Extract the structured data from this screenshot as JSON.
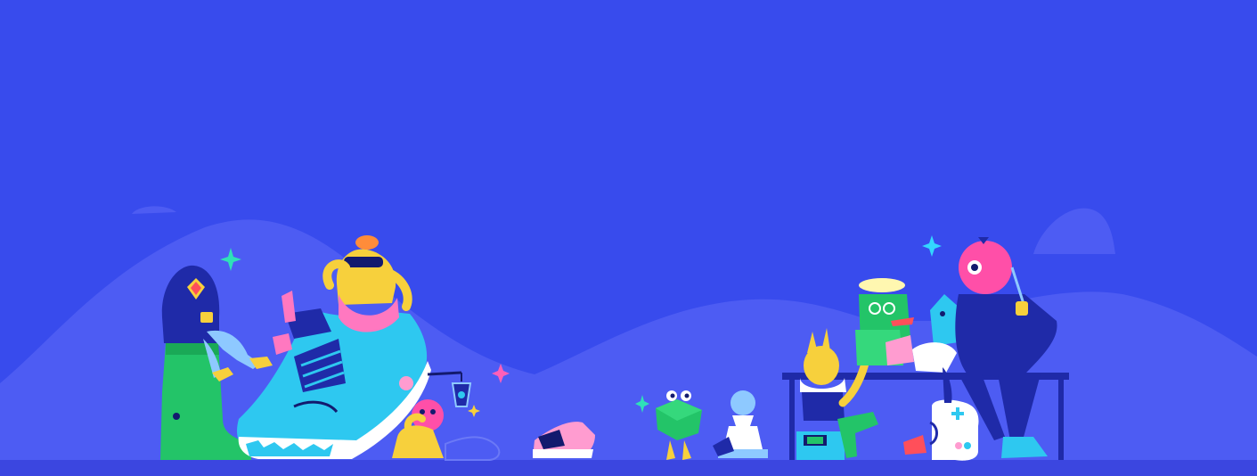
{
  "colors": {
    "sky": "#384bed",
    "hills": "#4d5cf3",
    "hills_light": "#5a68f5",
    "ground": "#3b46e0",
    "navy": "#1f2aa8",
    "dark_outline": "#131a6e",
    "green": "#23c468",
    "cyan": "#2ec8f0",
    "yellow": "#f7d03c",
    "pink": "#ff4fa8",
    "light_pink": "#ff9cd0",
    "white": "#ffffff",
    "light_blue": "#8ec9ff"
  },
  "icons": [
    "sparkle-icon",
    "boot-icon",
    "sneaker-icon",
    "lantern-icon",
    "gamepad-icon",
    "chess-pawn-icon",
    "dice-icon"
  ]
}
